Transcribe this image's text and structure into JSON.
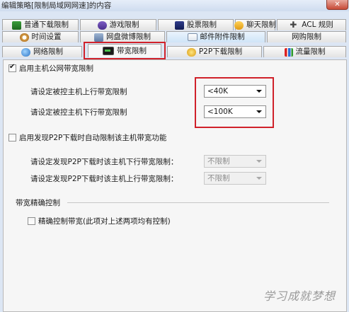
{
  "window": {
    "title": "编辑策略[限制局域网网速]的内容",
    "close_label": "✕"
  },
  "tabs": {
    "row1": [
      {
        "label": "普通下载限制",
        "icon": "download-icon"
      },
      {
        "label": "游戏限制",
        "icon": "game-icon"
      },
      {
        "label": "股票限制",
        "icon": "stock-icon"
      },
      {
        "label": "聊天限制",
        "icon": "chat-icon"
      },
      {
        "label": "ACL 规则",
        "icon": "acl-rules-icon"
      }
    ],
    "row2": [
      {
        "label": "时间设置",
        "icon": "clock-icon"
      },
      {
        "label": "网盘微博限制",
        "icon": "netdisk-icon"
      },
      {
        "label": "邮件附件限制",
        "icon": "mail-icon"
      },
      {
        "label": "网购限制",
        "icon": ""
      }
    ],
    "row3": [
      {
        "label": "网络限制",
        "icon": "globe-icon"
      },
      {
        "label": "带宽限制",
        "icon": "bandwidth-icon"
      },
      {
        "label": "P2P下载限制",
        "icon": "p2p-icon"
      },
      {
        "label": "流量限制",
        "icon": "traffic-chart-icon"
      }
    ],
    "active": "带宽限制"
  },
  "bandwidth": {
    "enable_label": "启用主机公网带宽限制",
    "enable_checked": true,
    "upload_label": "请设定被控主机上行带宽限制",
    "upload_value": "<40K",
    "download_label": "请设定被控主机下行带宽限制",
    "download_value": "<100K"
  },
  "p2p": {
    "enable_label": "启用发现P2P下载时自动限制该主机带宽功能",
    "enable_checked": false,
    "download_label": "请设定发现P2P下载时该主机下行带宽限制：",
    "download_value": "不限制",
    "upload_label": "请设定发现P2P下载时该主机上行带宽限制：",
    "upload_value": "不限制"
  },
  "precise": {
    "group_label": "带宽精确控制",
    "checkbox_label": "精确控制带宽(此项对上述两项均有控制)",
    "checked": false
  },
  "watermark": "学习成就梦想",
  "colors": {
    "highlight_border": "#d0212a",
    "window_bg": "#dce6f4",
    "panel_bg": "#f6f6f6"
  }
}
